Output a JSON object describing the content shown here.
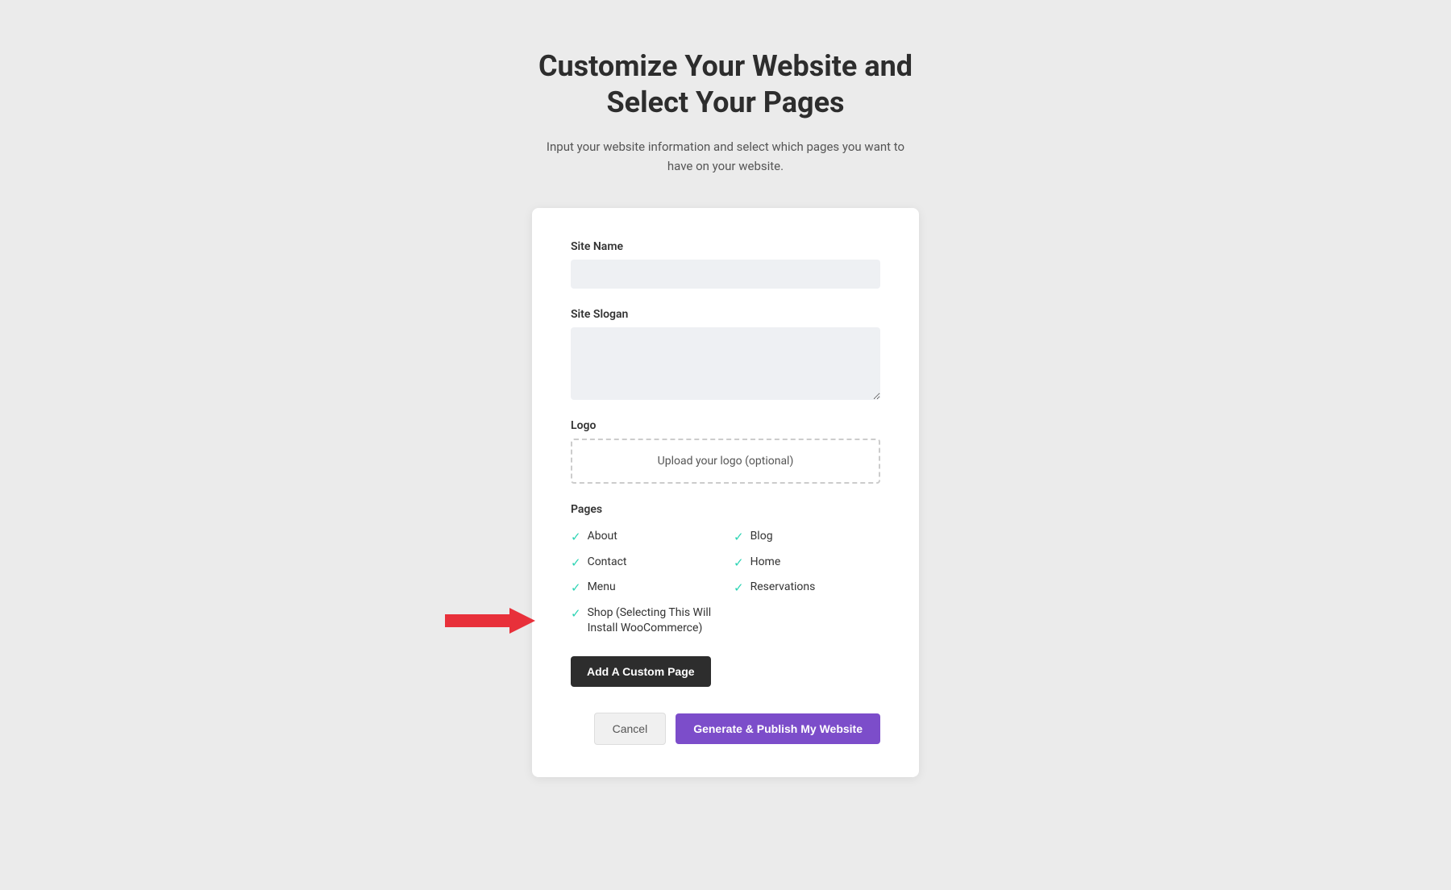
{
  "header": {
    "title_line1": "Customize Your Website and",
    "title_line2": "Select Your Pages",
    "subtitle": "Input your website information and select which pages you want to have on your website."
  },
  "form": {
    "site_name_label": "Site Name",
    "site_name_placeholder": "",
    "site_slogan_label": "Site Slogan",
    "site_slogan_placeholder": "",
    "logo_label": "Logo",
    "logo_upload_text": "Upload your logo (optional)",
    "pages_label": "Pages",
    "pages": [
      {
        "id": "about",
        "label": "About",
        "checked": true,
        "col": 1
      },
      {
        "id": "blog",
        "label": "Blog",
        "checked": true,
        "col": 2
      },
      {
        "id": "contact",
        "label": "Contact",
        "checked": true,
        "col": 1
      },
      {
        "id": "home",
        "label": "Home",
        "checked": true,
        "col": 2
      },
      {
        "id": "menu",
        "label": "Menu",
        "checked": true,
        "col": 1
      },
      {
        "id": "reservations",
        "label": "Reservations",
        "checked": true,
        "col": 2
      },
      {
        "id": "shop",
        "label": "Shop (Selecting This Will Install WooCommerce)",
        "checked": true,
        "col": 1,
        "full_width": false
      }
    ],
    "add_custom_page_label": "Add A Custom Page",
    "cancel_label": "Cancel",
    "publish_label": "Generate & Publish My Website"
  },
  "colors": {
    "check": "#2dd4b4",
    "add_btn_bg": "#2d2d2d",
    "publish_btn_bg": "#7c4dca",
    "arrow": "#e8303a"
  }
}
